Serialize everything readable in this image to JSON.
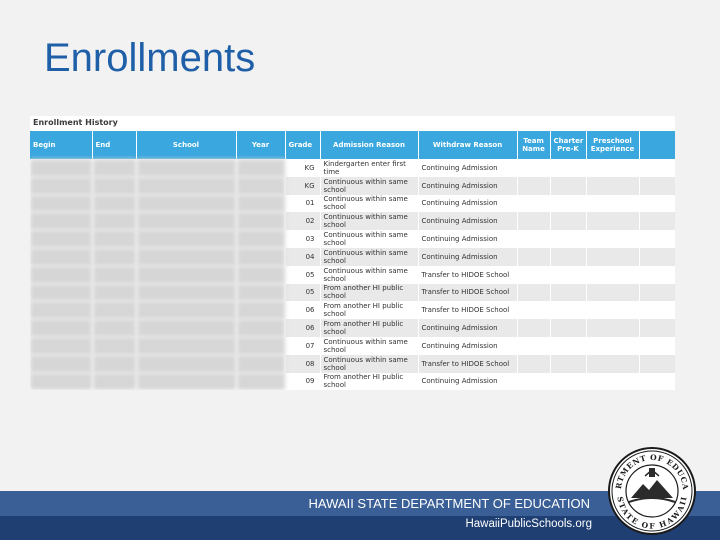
{
  "slide": {
    "title": "Enrollments"
  },
  "panel": {
    "title": "Enrollment History"
  },
  "table": {
    "headers": {
      "begin": "Begin",
      "end": "End",
      "school": "School",
      "year": "Year",
      "grade": "Grade",
      "admission_reason": "Admission Reason",
      "withdraw_reason": "Withdraw Reason",
      "team_name_1": "Team",
      "team_name_2": "Name",
      "charter_1": "Charter",
      "charter_2": "Pre-K",
      "preschool_1": "Preschool",
      "preschool_2": "Experience"
    },
    "rows": [
      {
        "grade": "KG",
        "admission": "Kindergarten enter first time",
        "withdraw": "Continuing Admission"
      },
      {
        "grade": "KG",
        "admission": "Continuous within same school",
        "withdraw": "Continuing Admission"
      },
      {
        "grade": "01",
        "admission": "Continuous within same school",
        "withdraw": "Continuing Admission"
      },
      {
        "grade": "02",
        "admission": "Continuous within same school",
        "withdraw": "Continuing Admission"
      },
      {
        "grade": "03",
        "admission": "Continuous within same school",
        "withdraw": "Continuing Admission"
      },
      {
        "grade": "04",
        "admission": "Continuous within same school",
        "withdraw": "Continuing Admission"
      },
      {
        "grade": "05",
        "admission": "Continuous within same school",
        "withdraw": "Transfer to HIDOE School"
      },
      {
        "grade": "05",
        "admission": "From another HI public school",
        "withdraw": "Transfer to HIDOE School"
      },
      {
        "grade": "06",
        "admission": "From another HI public school",
        "withdraw": "Transfer to HIDOE School"
      },
      {
        "grade": "06",
        "admission": "From another HI public school",
        "withdraw": "Continuing Admission"
      },
      {
        "grade": "07",
        "admission": "Continuous within same school",
        "withdraw": "Continuing Admission"
      },
      {
        "grade": "08",
        "admission": "Continuous within same school",
        "withdraw": "Transfer to HIDOE School"
      },
      {
        "grade": "09",
        "admission": "From another HI public school",
        "withdraw": "Continuing Admission"
      }
    ]
  },
  "footer": {
    "department": "HAWAII STATE DEPARTMENT OF EDUCATION",
    "url": "HawaiiPublicSchools.org",
    "seal_text_top": "DEPARTMENT OF EDUCATION",
    "seal_text_bottom": "STATE OF HAWAII"
  },
  "colors": {
    "title": "#1f5fa8",
    "header_bg": "#3aa8df",
    "footer_light": "#3a5f96",
    "footer_dark": "#1f3f73"
  }
}
